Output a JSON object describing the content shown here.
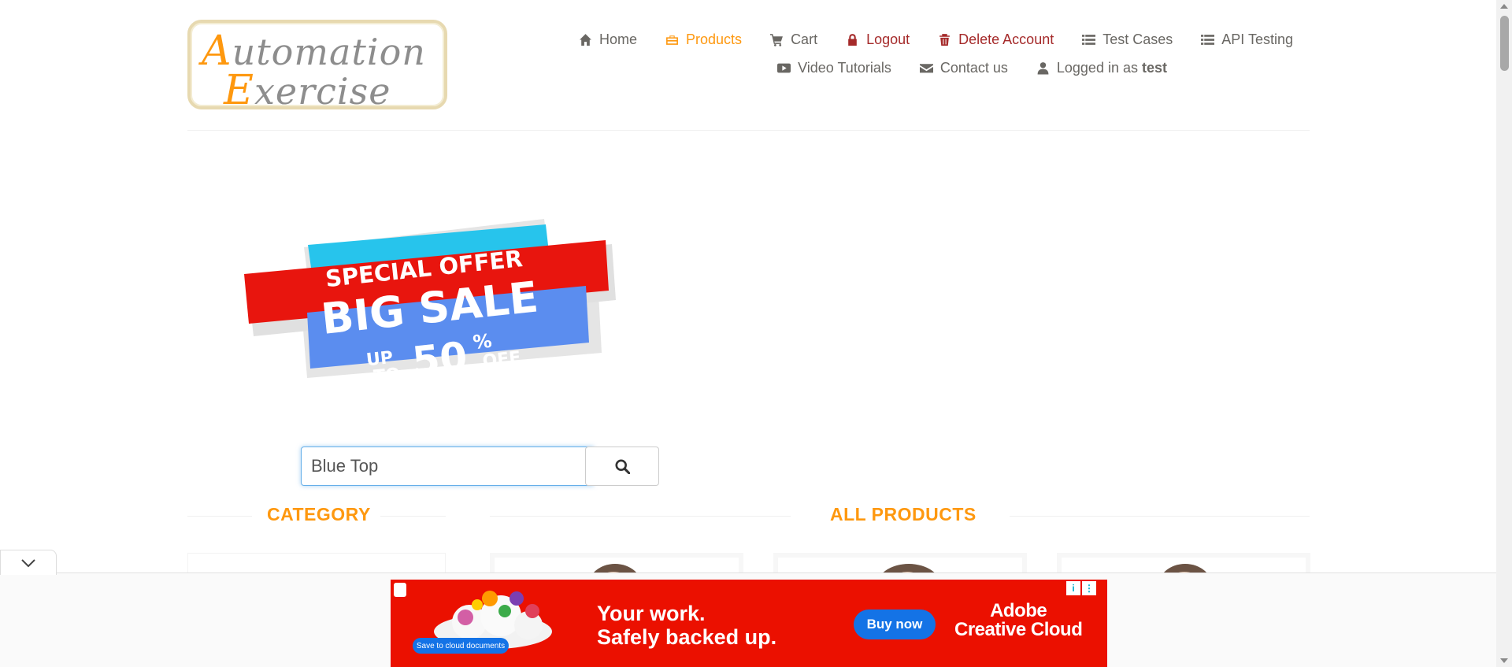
{
  "logo": {
    "line1_cap": "A",
    "line1_rest": "utomation",
    "line2_cap": "E",
    "line2_rest": "xercise"
  },
  "nav": {
    "row1": [
      {
        "key": "home",
        "label": "Home",
        "icon": "home-icon"
      },
      {
        "key": "products",
        "label": "Products",
        "icon": "briefcase-icon",
        "active": true
      },
      {
        "key": "cart",
        "label": "Cart",
        "icon": "cart-icon"
      },
      {
        "key": "logout",
        "label": "Logout",
        "icon": "lock-icon"
      },
      {
        "key": "delete-account",
        "label": "Delete Account",
        "icon": "trash-icon"
      },
      {
        "key": "test-cases",
        "label": "Test Cases",
        "icon": "list-icon"
      },
      {
        "key": "api-testing",
        "label": "API Testing",
        "icon": "list-icon"
      }
    ],
    "row2": {
      "video_tutorials": "Video Tutorials",
      "contact_us": "Contact us",
      "logged_in_prefix": "Logged in as",
      "username": "test"
    }
  },
  "banner": {
    "line1": "SPECIAL OFFER",
    "line2": "BIG SALE",
    "up": "UP",
    "to": "TO",
    "percent_value": "50",
    "percent_sign": "%",
    "off": "OFF"
  },
  "search": {
    "value": "Blue Top"
  },
  "sections": {
    "category": "CATEGORY",
    "all_products": "ALL PRODUCTS"
  },
  "ad": {
    "headline_1": "Your work.",
    "headline_2": "Safely backed up.",
    "button": "Buy now",
    "brand_1": "Adobe",
    "brand_2": "Creative Cloud",
    "cloud_label": "Save to cloud documents",
    "info_glyph": "i",
    "menu_glyph": "⋮"
  },
  "colors": {
    "accent": "#fe980f",
    "danger": "#a52a2a",
    "ad_red": "#eb1000",
    "ad_blue": "#1473e6"
  }
}
